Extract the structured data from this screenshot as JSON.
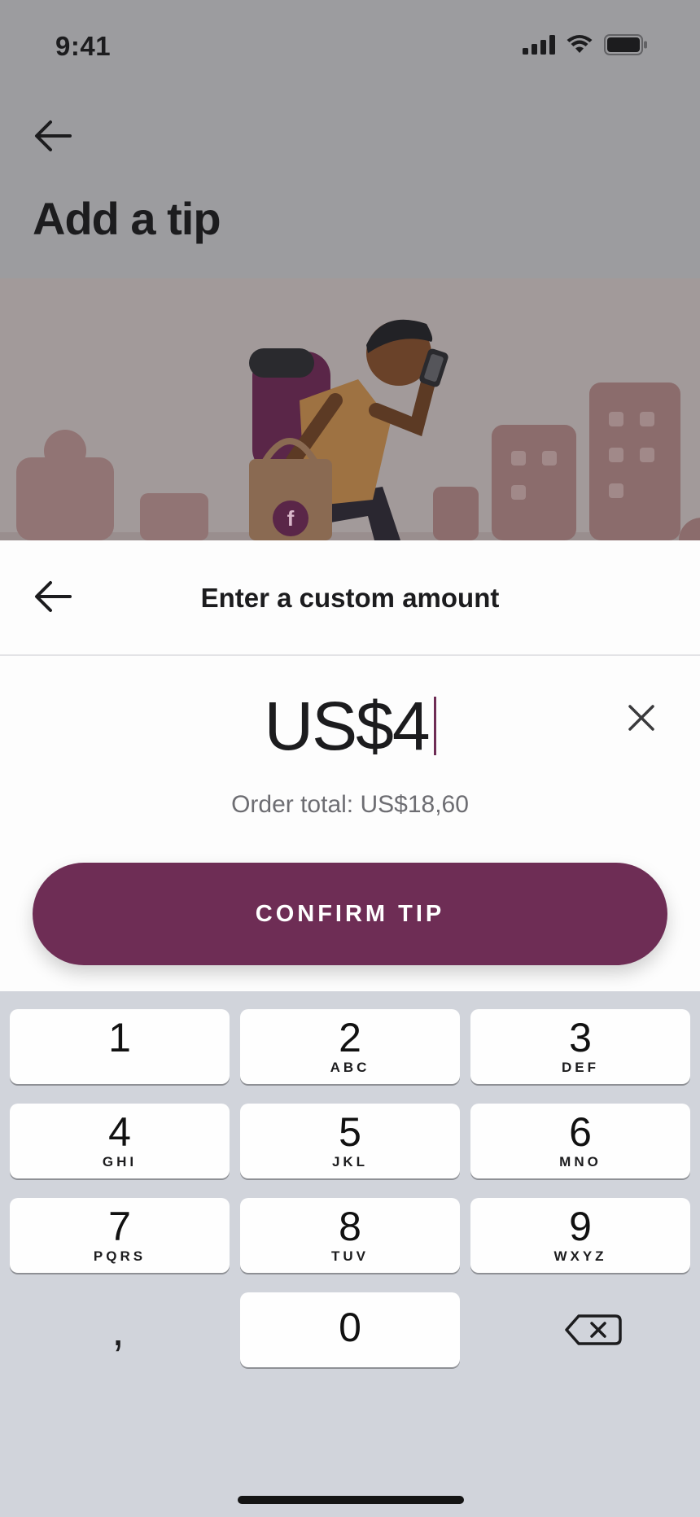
{
  "status_bar": {
    "time": "9:41"
  },
  "background_screen": {
    "title": "Add a tip",
    "bag_logo_letter": "f"
  },
  "sheet": {
    "title": "Enter a custom amount",
    "amount": "US$4",
    "order_total": "Order total: US$18,60",
    "confirm_label": "CONFIRM TIP"
  },
  "keypad": {
    "keys": [
      {
        "num": "1",
        "letters": ""
      },
      {
        "num": "2",
        "letters": "ABC"
      },
      {
        "num": "3",
        "letters": "DEF"
      },
      {
        "num": "4",
        "letters": "GHI"
      },
      {
        "num": "5",
        "letters": "JKL"
      },
      {
        "num": "6",
        "letters": "MNO"
      },
      {
        "num": "7",
        "letters": "PQRS"
      },
      {
        "num": "8",
        "letters": "TUV"
      },
      {
        "num": "9",
        "letters": "WXYZ"
      },
      {
        "num": "0",
        "letters": ""
      }
    ],
    "decimal_key": ","
  },
  "colors": {
    "accent": "#6e2d55",
    "keypad_bg": "#d1d4db",
    "dim_overlay": "#9c9c9f"
  },
  "icons": [
    "back-arrow-icon",
    "close-icon",
    "backspace-icon",
    "signal-icon",
    "wifi-icon",
    "battery-icon"
  ]
}
